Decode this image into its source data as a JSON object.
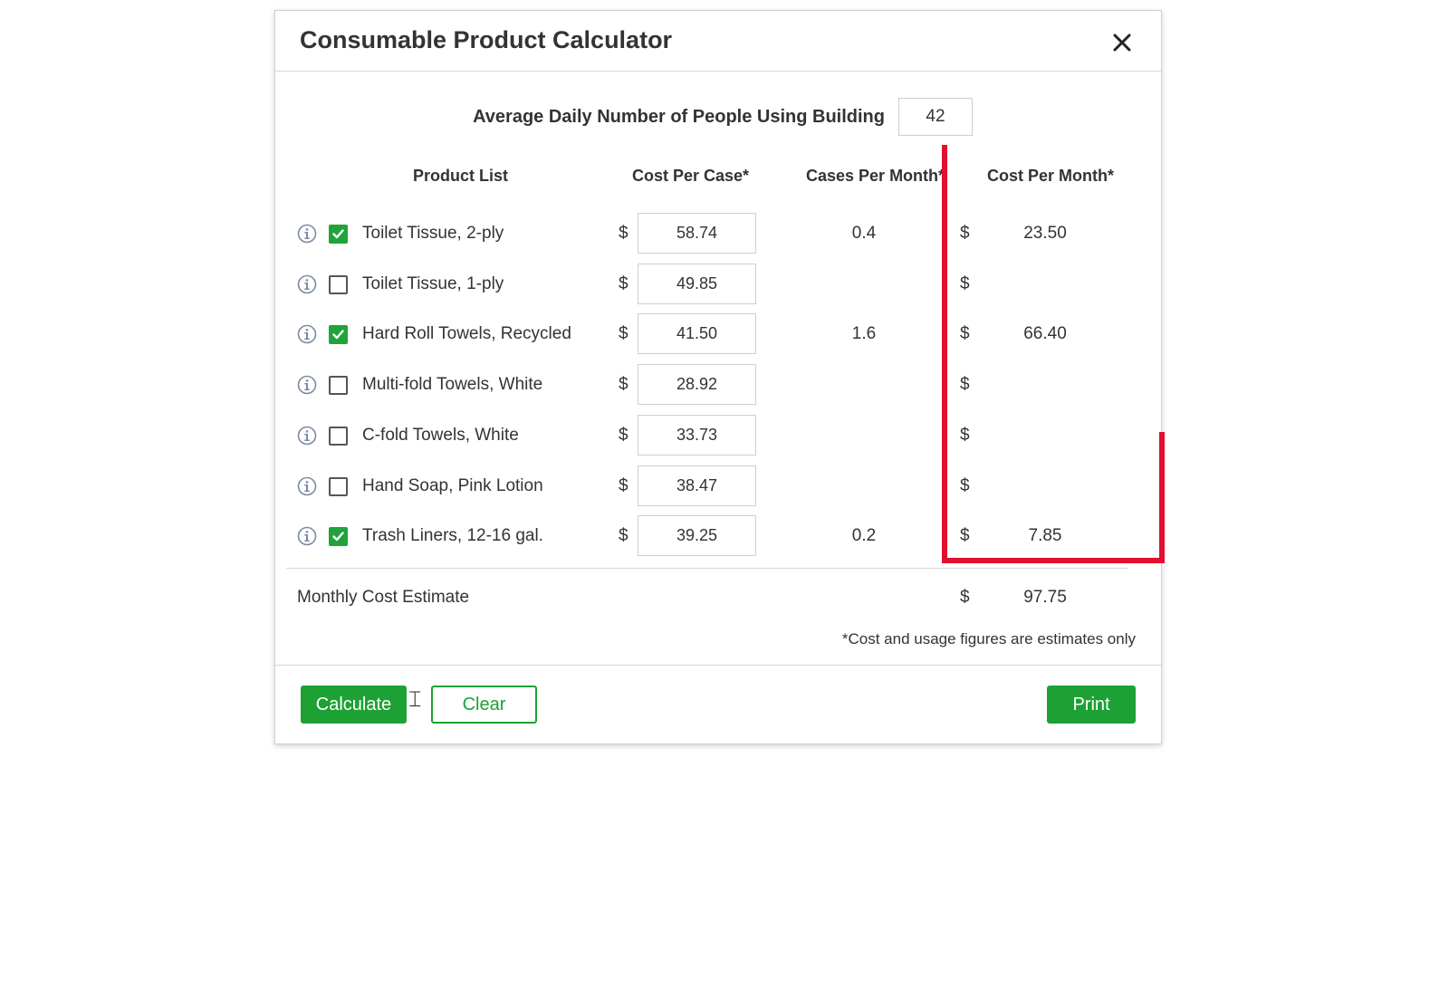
{
  "dialog": {
    "title": "Consumable Product Calculator",
    "close_icon": "close-icon"
  },
  "people": {
    "label": "Average Daily Number of People Using Building",
    "value": "42"
  },
  "columns": {
    "product_list": "Product List",
    "cost_per_case": "Cost Per Case*",
    "cases_per_month": "Cases Per Month*",
    "cost_per_month": "Cost Per Month*"
  },
  "currency_symbol": "$",
  "products": [
    {
      "name": "Toilet Tissue, 2-ply",
      "checked": true,
      "cost_per_case": "58.74",
      "cases_per_month": "0.4",
      "cost_per_month": "23.50"
    },
    {
      "name": "Toilet Tissue, 1-ply",
      "checked": false,
      "cost_per_case": "49.85",
      "cases_per_month": "",
      "cost_per_month": ""
    },
    {
      "name": "Hard Roll Towels, Recycled",
      "checked": true,
      "cost_per_case": "41.50",
      "cases_per_month": "1.6",
      "cost_per_month": "66.40"
    },
    {
      "name": "Multi-fold Towels, White",
      "checked": false,
      "cost_per_case": "28.92",
      "cases_per_month": "",
      "cost_per_month": ""
    },
    {
      "name": "C-fold Towels, White",
      "checked": false,
      "cost_per_case": "33.73",
      "cases_per_month": "",
      "cost_per_month": ""
    },
    {
      "name": "Hand Soap, Pink Lotion",
      "checked": false,
      "cost_per_case": "38.47",
      "cases_per_month": "",
      "cost_per_month": ""
    },
    {
      "name": "Trash Liners, 12-16 gal.",
      "checked": true,
      "cost_per_case": "39.25",
      "cases_per_month": "0.2",
      "cost_per_month": "7.85"
    }
  ],
  "total": {
    "label": "Monthly Cost Estimate",
    "value": "97.75"
  },
  "footnote": "*Cost and usage figures are estimates only",
  "buttons": {
    "calculate": "Calculate",
    "clear": "Clear",
    "print": "Print"
  },
  "colors": {
    "accent_green": "#1ea134",
    "highlight_red": "#e0102f"
  }
}
